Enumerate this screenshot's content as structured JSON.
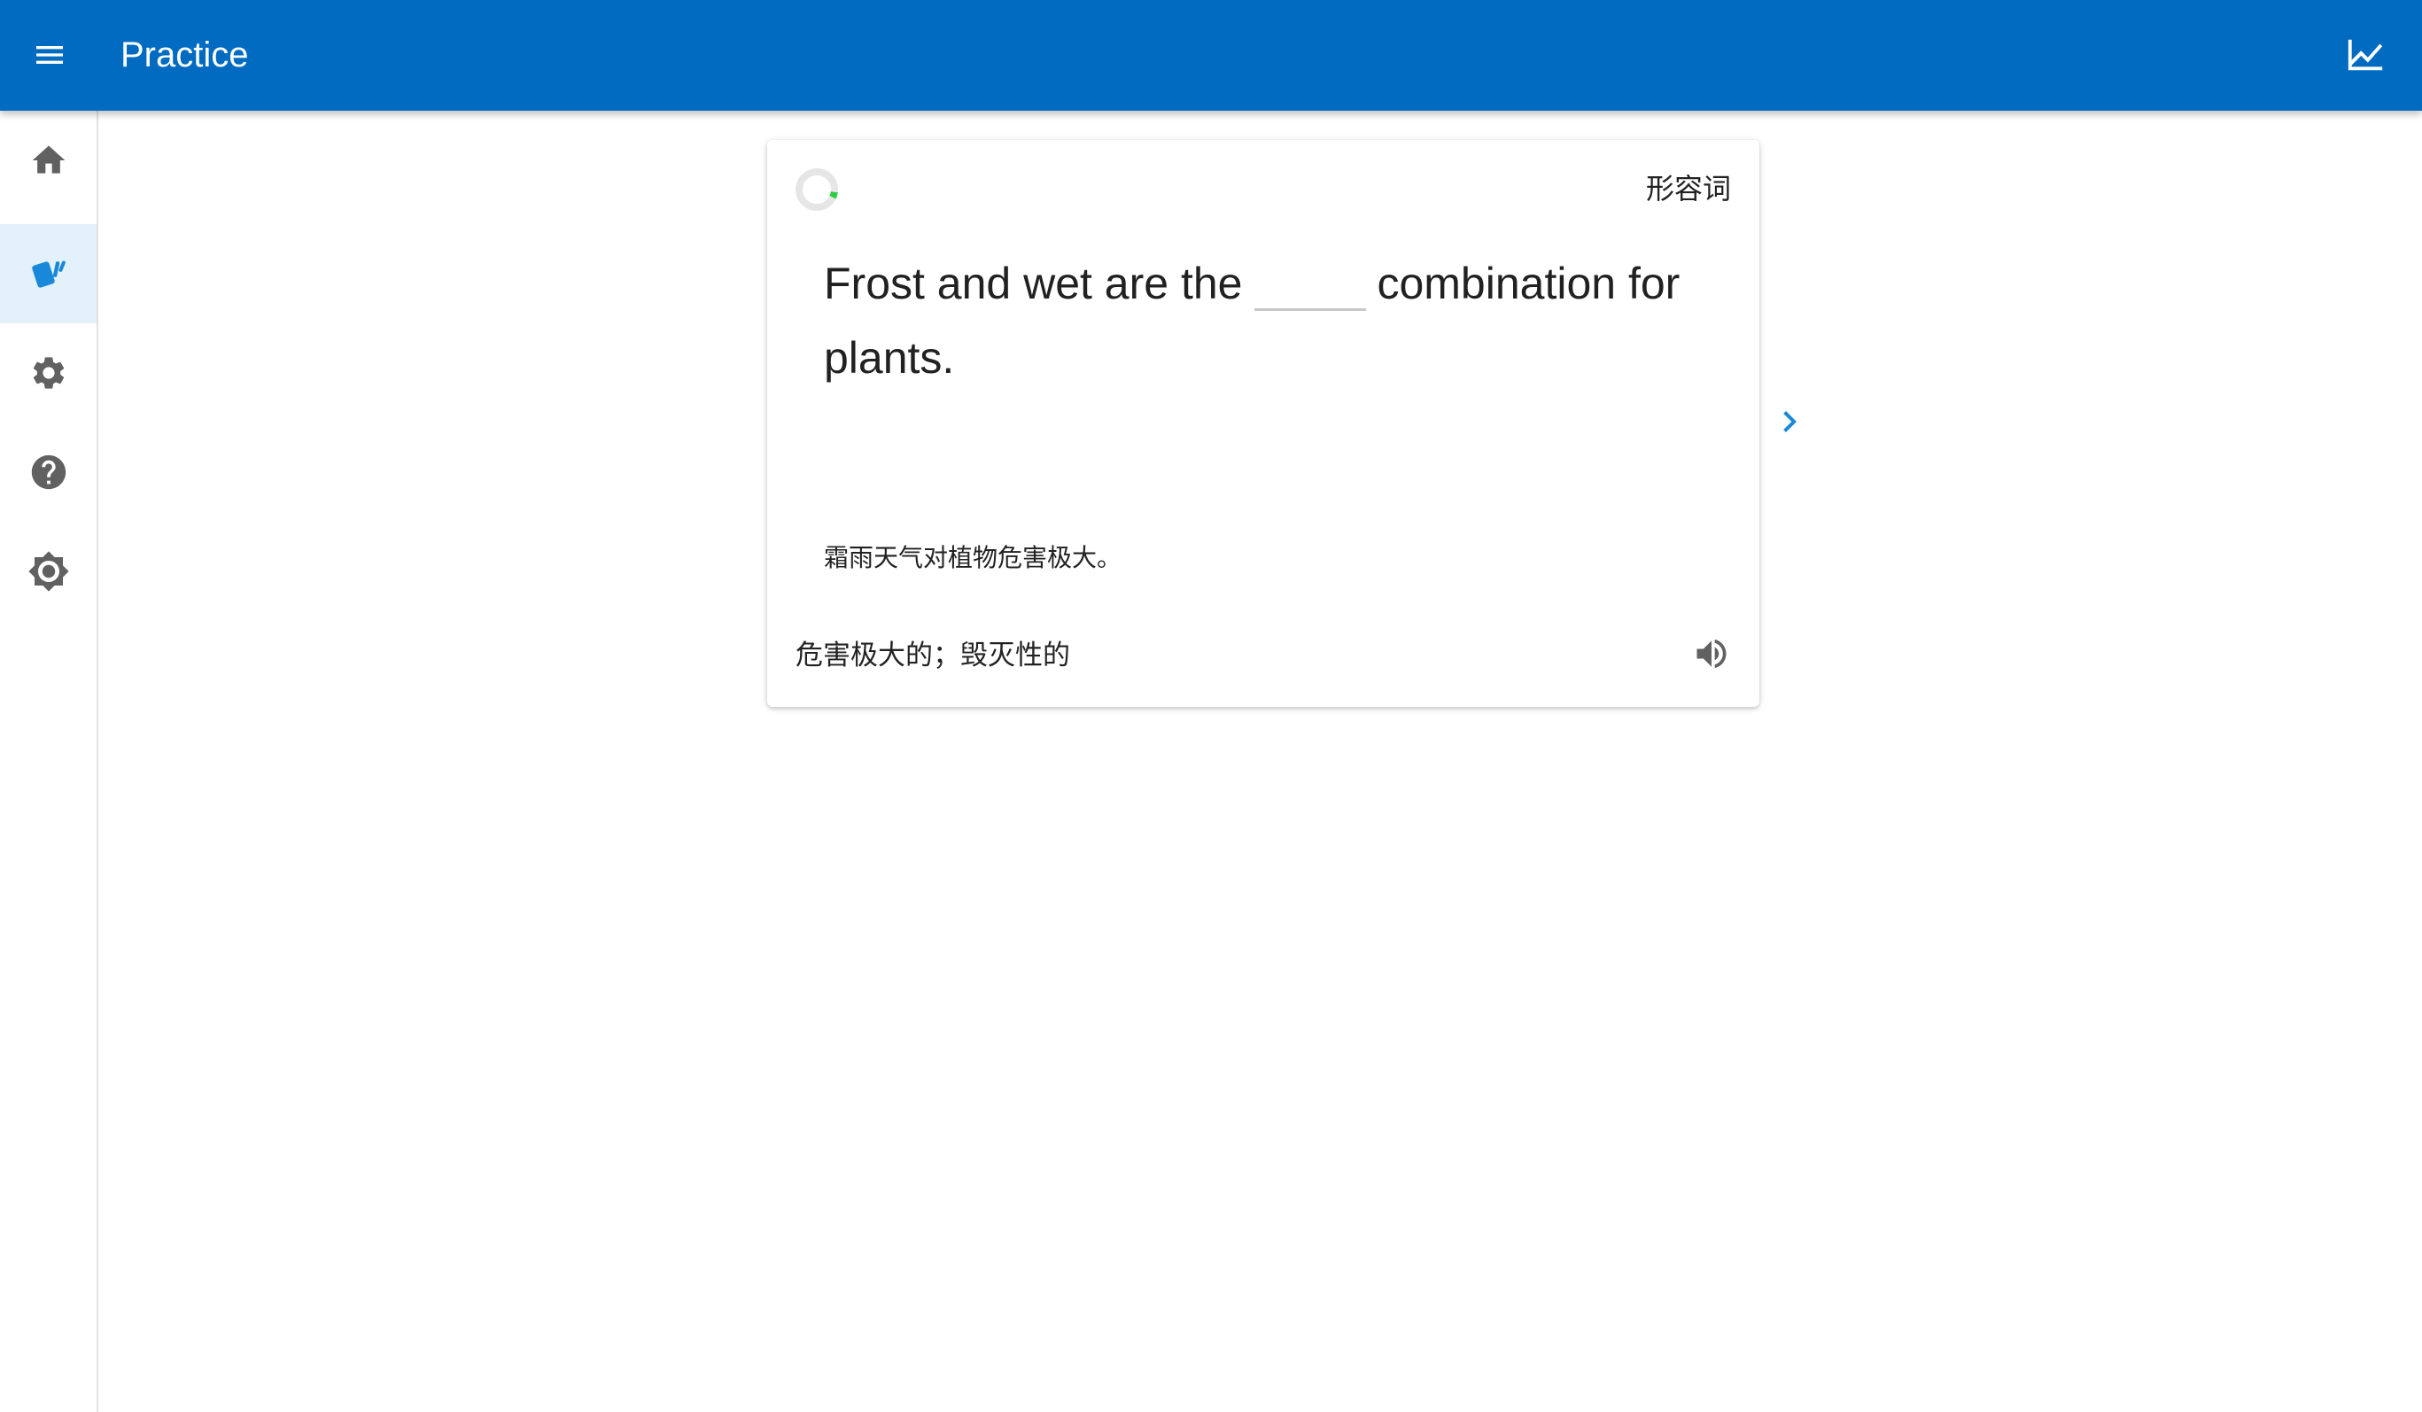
{
  "appbar": {
    "title": "Practice",
    "menu_icon": "menu-icon",
    "stats_icon": "line-chart-icon",
    "color": "#006bc1"
  },
  "nav": {
    "items": [
      {
        "name": "home",
        "icon": "home-icon",
        "active": false
      },
      {
        "name": "practice",
        "icon": "cards-icon",
        "active": true
      },
      {
        "name": "settings",
        "icon": "gear-icon",
        "active": false
      },
      {
        "name": "help",
        "icon": "help-circle-icon",
        "active": false
      },
      {
        "name": "theme",
        "icon": "brightness-icon",
        "active": false
      }
    ],
    "active_color": "#1a88d9"
  },
  "card": {
    "progress_fraction": 0.05,
    "progress_color": "#2ecc40",
    "word_class": "形容词",
    "sentence_before": "Frost and wet are the",
    "sentence_after": "combination for plants.",
    "blank_value": "",
    "translation": "霜雨天气对植物危害极大。",
    "definition": "危害极大的；毁灭性的",
    "speaker_icon": "volume-icon"
  },
  "next": {
    "icon": "chevron-right-icon",
    "color": "#1a88d9"
  }
}
